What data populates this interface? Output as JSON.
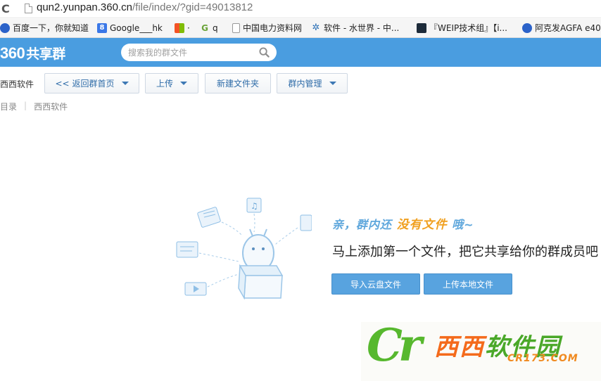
{
  "browser": {
    "url_host": "qun2.yunpan.360.cn",
    "url_path": "/file/index/?gid=49013812",
    "bookmarks": [
      {
        "label": "百度一下，你就知道",
        "icon": "paw-icon"
      },
      {
        "label": "Google___hk",
        "icon": "google-icon"
      },
      {
        "label": "·",
        "icon": "windows-icon"
      },
      {
        "label": "q",
        "icon": "green-g-icon"
      },
      {
        "label": "中国电力资料网",
        "icon": "page-icon"
      },
      {
        "label": "软件 - 水世界 - 中...",
        "icon": "star-icon"
      },
      {
        "label": "『WEIP技术组』【i...",
        "icon": "weip-icon"
      },
      {
        "label": "阿克发AGFA e40",
        "icon": "paw-icon"
      }
    ]
  },
  "header": {
    "logo_num": "360",
    "logo_text": "共享群",
    "search_placeholder": "搜索我的群文件"
  },
  "toolbar": {
    "group_name": "西西软件",
    "back_label": "返回群首页",
    "back_prefix": "<<",
    "upload_label": "上传",
    "new_folder_label": "新建文件夹",
    "manage_label": "群内管理"
  },
  "breadcrumb": {
    "root": "目录",
    "separator": "|",
    "current": "西西软件"
  },
  "empty_state": {
    "tag_prefix": "亲，群内还",
    "tag_highlight": "没有文件",
    "tag_suffix": "哦~",
    "message": "马上添加第一个文件，把它共享给你的群成员吧",
    "import_button": "导入云盘文件",
    "upload_button": "上传本地文件"
  },
  "watermark": {
    "cr": "Cr",
    "name_a": "西西",
    "name_b": "软件园",
    "domain": "CR173.COM"
  },
  "colors": {
    "header_blue": "#4a9de0",
    "button_blue": "#58a3df",
    "link_blue": "#2f6ca8",
    "highlight_orange": "#f0a020"
  }
}
